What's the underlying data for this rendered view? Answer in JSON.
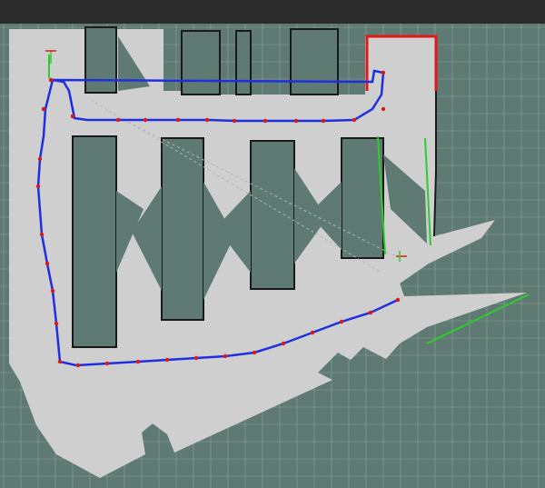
{
  "app": {
    "view": "rviz-map-display"
  },
  "colors": {
    "background_dark": "#2b2b2b",
    "unknown_space": "#5f7a72",
    "free_space": "#cfcfcf",
    "obstacle": "#1a1a1a",
    "grid_line": "#8ea49e",
    "planned_path": "#1f2fe0",
    "waypoint": "#d61a1a",
    "laser_green": "#2ecc2e",
    "laser_red": "#e01818"
  },
  "legend_icons": {
    "origin_axis": "origin-axis-icon",
    "robot_pose": "robot-pose-icon"
  }
}
